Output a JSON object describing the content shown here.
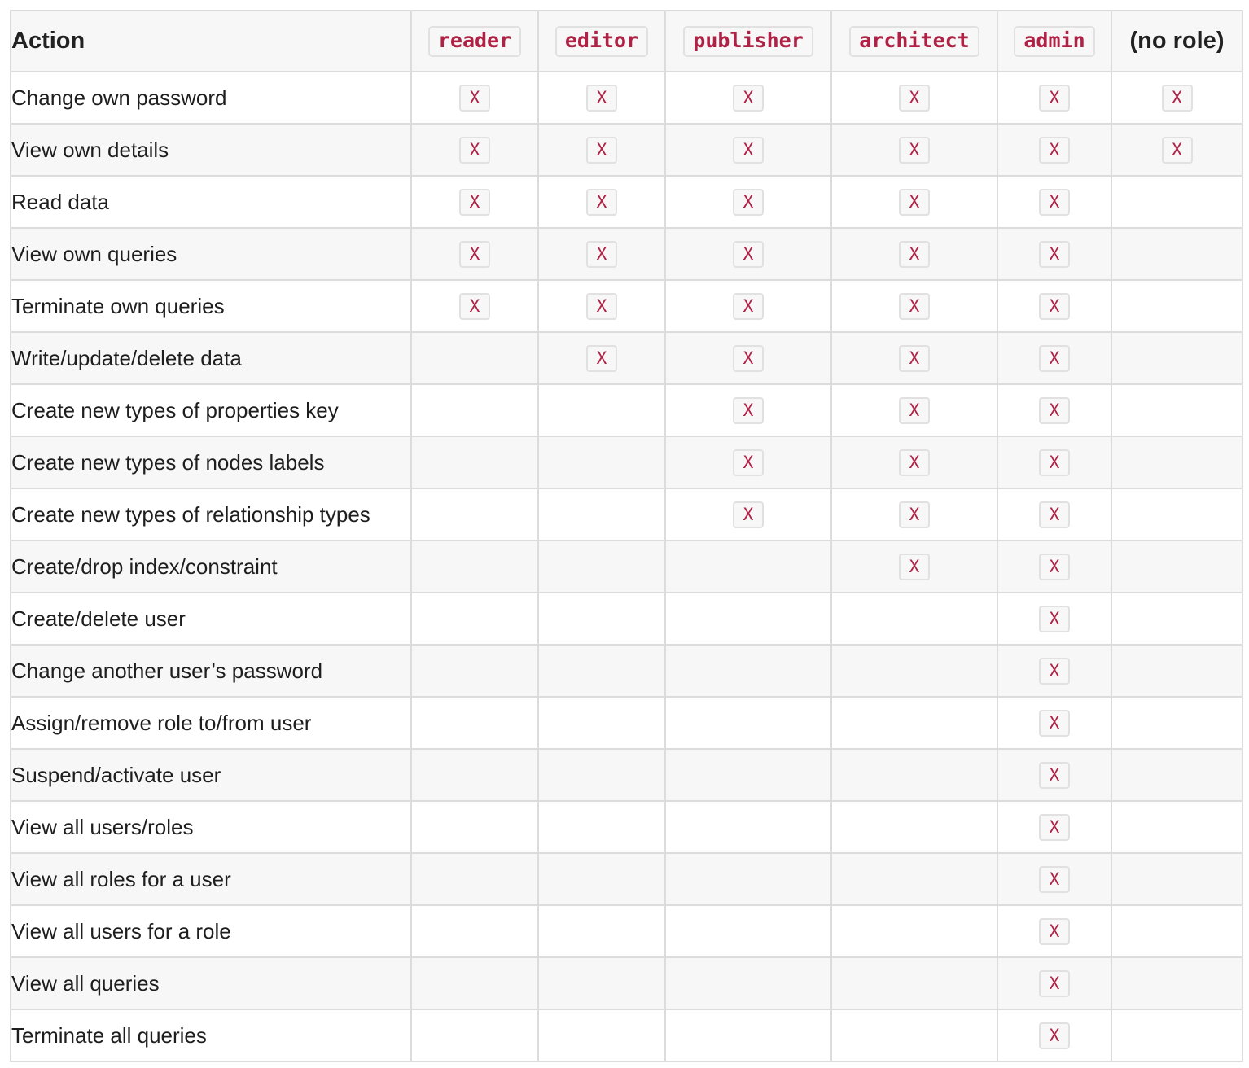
{
  "table": {
    "action_header": "Action",
    "role_headers": [
      "reader",
      "editor",
      "publisher",
      "architect",
      "admin"
    ],
    "no_role_header": "(no role)",
    "mark_symbol": "X",
    "rows": [
      {
        "action": "Change own password",
        "marks": [
          true,
          true,
          true,
          true,
          true,
          true
        ]
      },
      {
        "action": "View own details",
        "marks": [
          true,
          true,
          true,
          true,
          true,
          true
        ]
      },
      {
        "action": "Read data",
        "marks": [
          true,
          true,
          true,
          true,
          true,
          false
        ]
      },
      {
        "action": "View own queries",
        "marks": [
          true,
          true,
          true,
          true,
          true,
          false
        ]
      },
      {
        "action": "Terminate own queries",
        "marks": [
          true,
          true,
          true,
          true,
          true,
          false
        ]
      },
      {
        "action": "Write/update/delete data",
        "marks": [
          false,
          true,
          true,
          true,
          true,
          false
        ]
      },
      {
        "action": "Create new types of properties key",
        "marks": [
          false,
          false,
          true,
          true,
          true,
          false
        ]
      },
      {
        "action": "Create new types of nodes labels",
        "marks": [
          false,
          false,
          true,
          true,
          true,
          false
        ]
      },
      {
        "action": "Create new types of relationship types",
        "marks": [
          false,
          false,
          true,
          true,
          true,
          false
        ]
      },
      {
        "action": "Create/drop index/constraint",
        "marks": [
          false,
          false,
          false,
          true,
          true,
          false
        ]
      },
      {
        "action": "Create/delete user",
        "marks": [
          false,
          false,
          false,
          false,
          true,
          false
        ]
      },
      {
        "action": "Change another user’s password",
        "marks": [
          false,
          false,
          false,
          false,
          true,
          false
        ]
      },
      {
        "action": "Assign/remove role to/from user",
        "marks": [
          false,
          false,
          false,
          false,
          true,
          false
        ]
      },
      {
        "action": "Suspend/activate user",
        "marks": [
          false,
          false,
          false,
          false,
          true,
          false
        ]
      },
      {
        "action": "View all users/roles",
        "marks": [
          false,
          false,
          false,
          false,
          true,
          false
        ]
      },
      {
        "action": "View all roles for a user",
        "marks": [
          false,
          false,
          false,
          false,
          true,
          false
        ]
      },
      {
        "action": "View all users for a role",
        "marks": [
          false,
          false,
          false,
          false,
          true,
          false
        ]
      },
      {
        "action": "View all queries",
        "marks": [
          false,
          false,
          false,
          false,
          true,
          false
        ]
      },
      {
        "action": "Terminate all queries",
        "marks": [
          false,
          false,
          false,
          false,
          true,
          false
        ]
      }
    ]
  },
  "colors": {
    "accent": "#b12146",
    "border": "#dcdcdc",
    "stripe": "#f7f7f7"
  }
}
